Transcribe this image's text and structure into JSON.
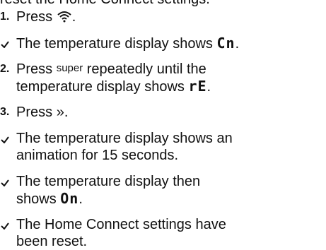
{
  "intro": "reset the Home Connect settings.",
  "steps": [
    {
      "num": "1.",
      "text": "Press ",
      "after": "."
    },
    {
      "check": "The temperature display shows ",
      "code": "Cn",
      "after": "."
    },
    {
      "num": "2.",
      "pre": "Press ",
      "small": "super",
      "post": " repeatedly until the",
      "line2pre": "temperature display shows ",
      "code": "rE",
      "after": "."
    },
    {
      "num": "3.",
      "pre": "Press ",
      "symbol": "»",
      "after": "."
    },
    {
      "line1": "The temperature display shows an",
      "line2": "animation for 15 seconds."
    },
    {
      "line1": "The temperature display then",
      "line2pre": "shows ",
      "code": "On",
      "after": "."
    },
    {
      "line1": "The Home Connect settings have",
      "line2": "been reset."
    }
  ]
}
